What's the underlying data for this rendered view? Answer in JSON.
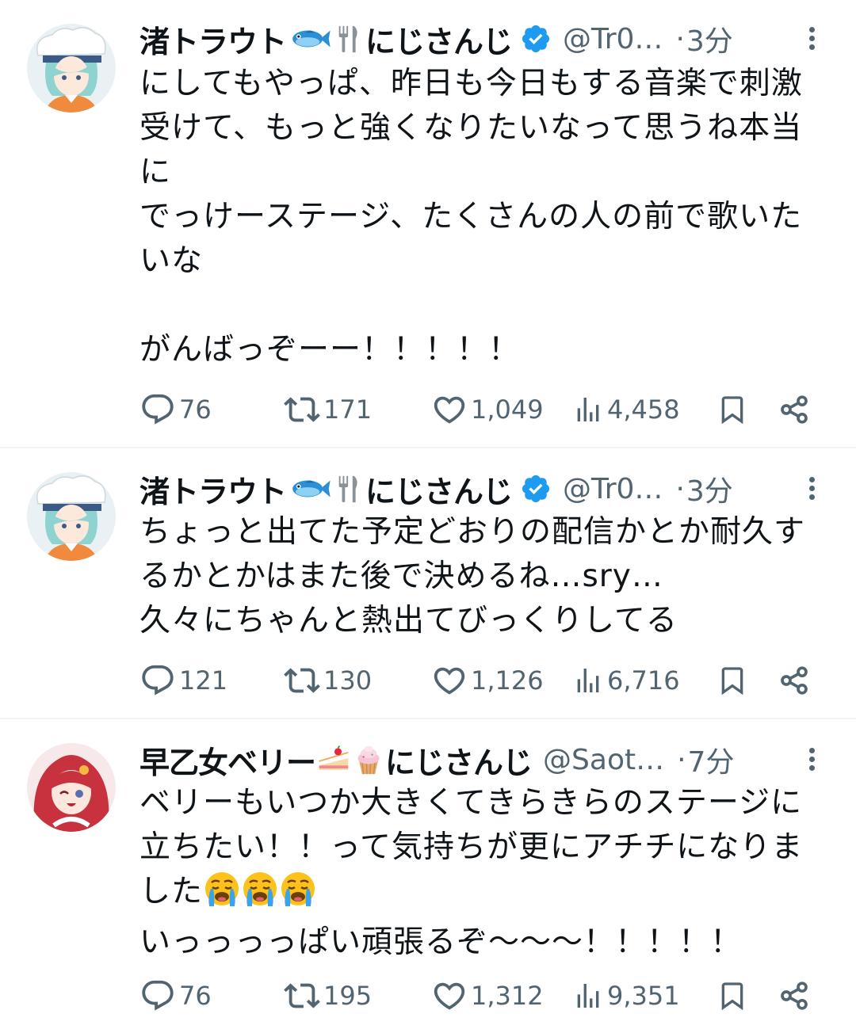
{
  "tweets": [
    {
      "display_name": "渚トラウト",
      "name_emojis": [
        "fish-emoji",
        "fork-knife-emoji"
      ],
      "org": "にじさんじ",
      "handle": "@Tr0…",
      "dot": "·",
      "time": "3分",
      "text": "にしてもやっぱ、昨日も今日もする音楽で刺激\n受けて、もっと強くなりたいなって思うね本当\nに\nでっけーステージ、たくさんの人の前で歌いた\nいな\n\nがんばっぞーー！！！！！",
      "replies": "76",
      "retweets": "171",
      "likes": "1,049",
      "views": "4,458"
    },
    {
      "display_name": "渚トラウト",
      "name_emojis": [
        "fish-emoji",
        "fork-knife-emoji"
      ],
      "org": "にじさんじ",
      "handle": "@Tr0…",
      "dot": "·",
      "time": "3分",
      "text": "ちょっと出てた予定どおりの配信かとか耐久す\nるかとかはまた後で決めるね…sry…\n久々にちゃんと熱出てびっくりしてる",
      "replies": "121",
      "retweets": "130",
      "likes": "1,126",
      "views": "6,716"
    },
    {
      "display_name": "早乙女ベリー",
      "name_emojis": [
        "cake-slice-emoji",
        "cupcake-emoji"
      ],
      "org": "にじさんじ",
      "handle": "@Saot…",
      "dot": "·",
      "time": "7分",
      "text_before_emoji": "ベリーもいつか大きくてきらきらのステージに\n立ちたい！！って気持ちが更にアチチになりま\nした",
      "text_emoji": "loudly-crying-face-emoji x3",
      "text_after_emoji": "\nいっっっっぱい頑張るぞ〜〜〜！！！！！",
      "replies": "76",
      "retweets": "195",
      "likes": "1,312",
      "views": "9,351"
    }
  ],
  "colors": {
    "text": "#0f1419",
    "secondary": "#536471",
    "verified": "#1d9bf0",
    "divider": "#eff3f4"
  }
}
